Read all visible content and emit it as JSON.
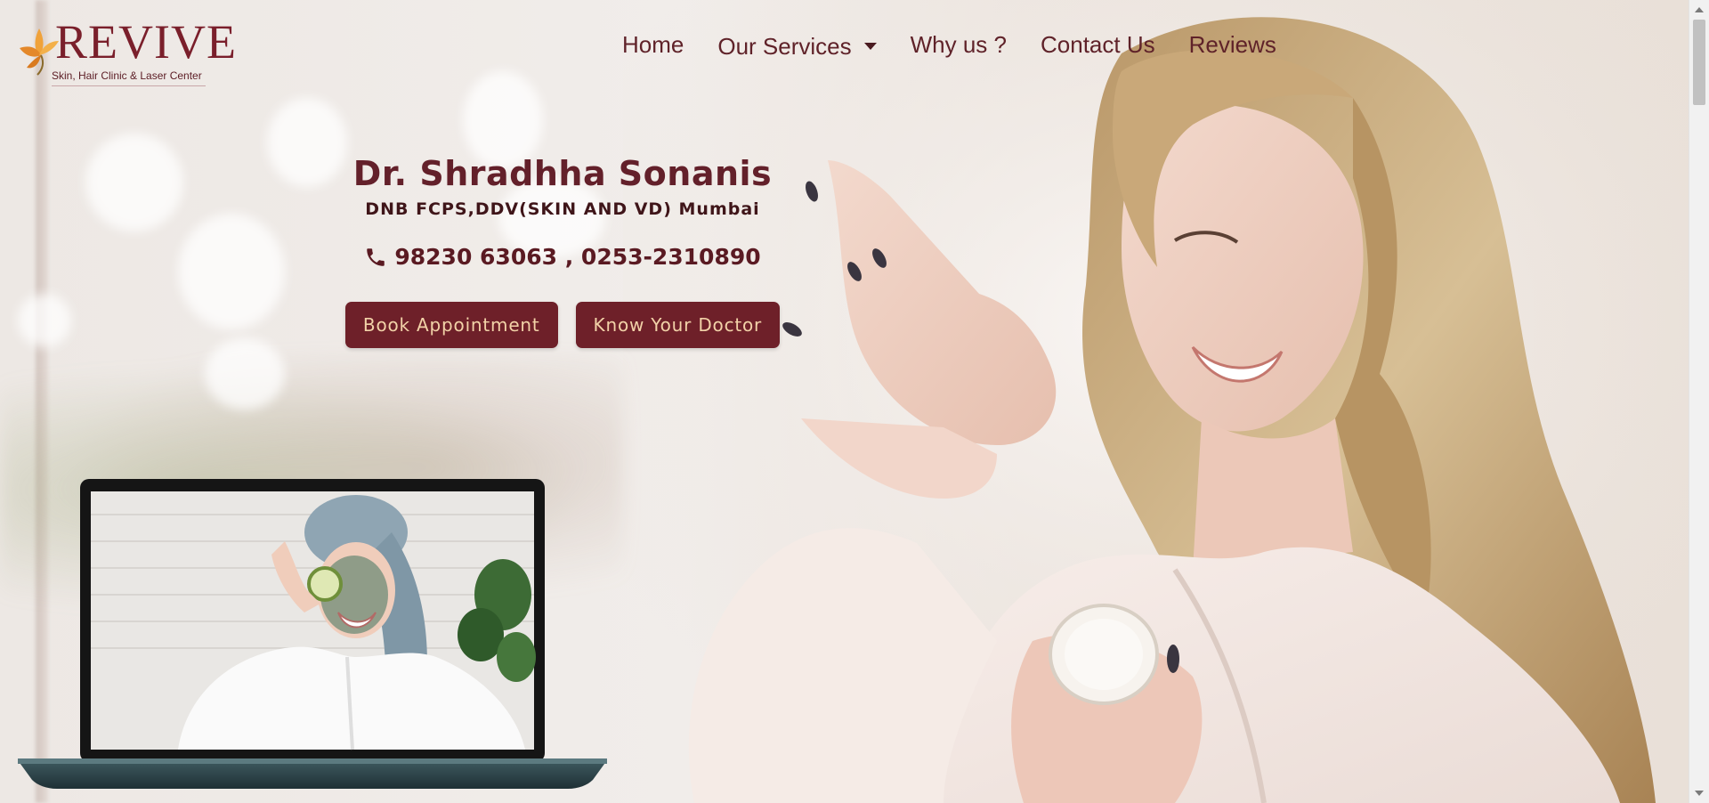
{
  "brand": {
    "logo_word": "REVIVE",
    "tagline": "Skin, Hair Clinic & Laser Center",
    "primary_color": "#6e2029",
    "button_text_color": "#f2d2a8"
  },
  "nav": {
    "items": [
      {
        "label": "Home"
      },
      {
        "label": "Our Services"
      },
      {
        "label": "Why us ?"
      },
      {
        "label": "Contact Us"
      },
      {
        "label": "Reviews"
      }
    ]
  },
  "hero": {
    "doctor_name": "Dr. Shradhha Sonanis",
    "qualifications": "DNB FCPS,DDV(SKIN AND VD) Mumbai",
    "phone_icon": "phone-icon",
    "phone": "98230 63063 , 0253-2310890",
    "book_button": "Book Appointment",
    "know_button": "Know Your Doctor"
  },
  "images": {
    "hero_photo": "woman-applying-cream",
    "laptop_photo": "woman-with-face-mask-and-cucumber"
  }
}
